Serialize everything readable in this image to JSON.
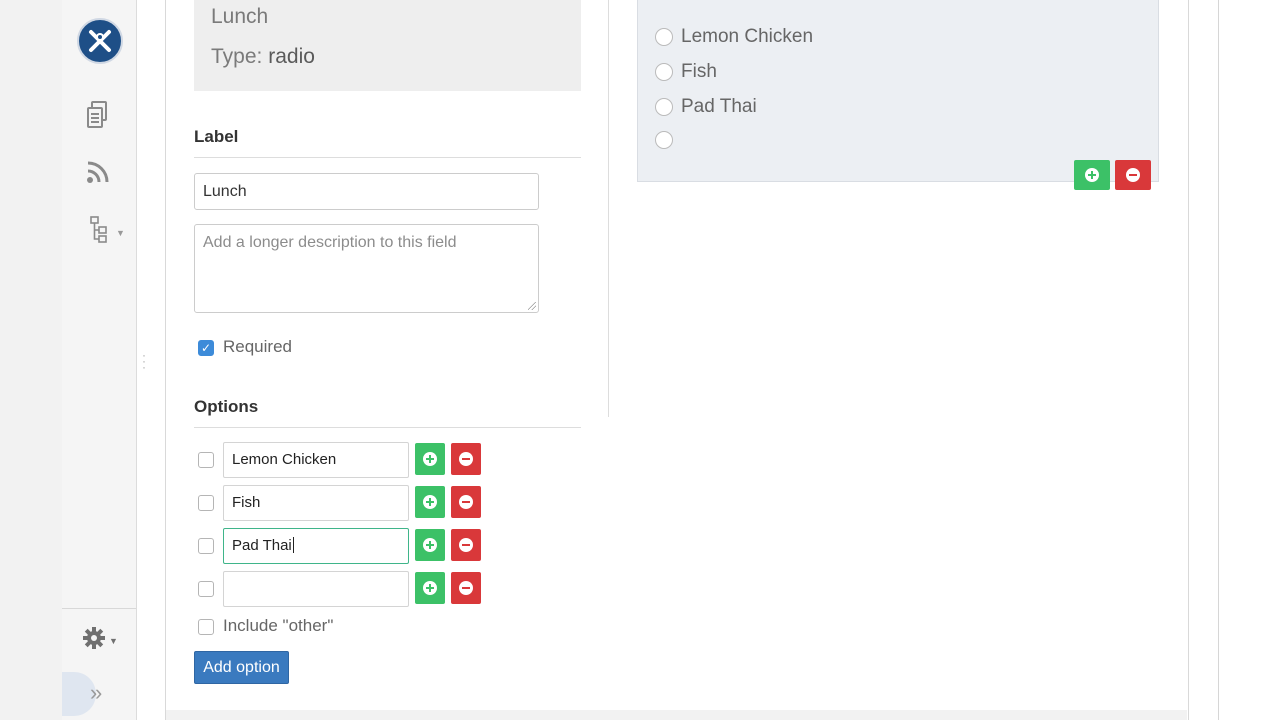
{
  "sidebar": {
    "logo_icon": "app-logo-icon",
    "icons": [
      "documents-icon",
      "rss-feed-icon",
      "sitemap-icon"
    ],
    "settings_icon": "gear-icon",
    "collapse_icon": "double-chevron-right-icon"
  },
  "field_summary": {
    "title": "Lunch",
    "type_label": "Type:",
    "type_value": "radio"
  },
  "label_section": {
    "heading": "Label",
    "label_value": "Lunch",
    "description_placeholder": "Add a longer description to this field",
    "required_label": "Required",
    "required_checked": true
  },
  "options_section": {
    "heading": "Options",
    "options": [
      {
        "value": "Lemon Chicken"
      },
      {
        "value": "Fish"
      },
      {
        "value": "Pad Thai"
      },
      {
        "value": ""
      }
    ],
    "include_other_label": "Include \"other\"",
    "add_option_label": "Add option"
  },
  "preview": {
    "radio_options": [
      "Lemon Chicken",
      "Fish",
      "Pad Thai",
      ""
    ]
  },
  "colors": {
    "add": "#3cc167",
    "remove": "#d9383a",
    "primary": "#3a7abf",
    "logo": "#1e4f87",
    "checkbox_checked": "#3d8bd9"
  }
}
